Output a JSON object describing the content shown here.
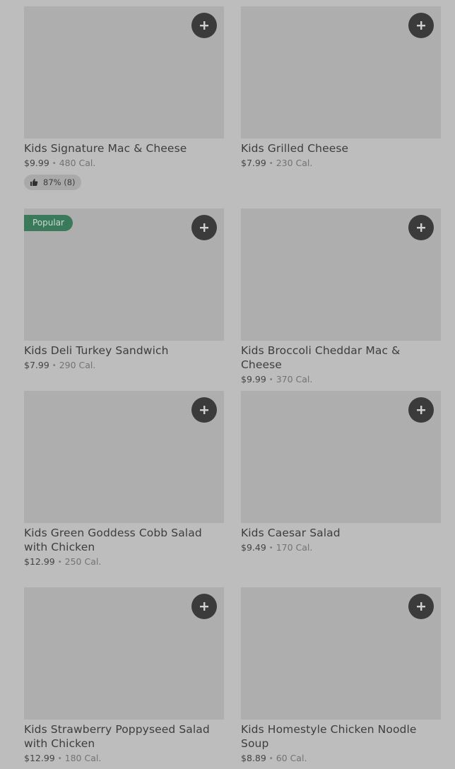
{
  "menu_items": [
    {
      "name": "Kids Signature Mac & Cheese",
      "price": "$9.99",
      "calories": "480 Cal.",
      "rating": "87% (8)"
    },
    {
      "name": "Kids Grilled Cheese",
      "price": "$7.99",
      "calories": "230 Cal."
    },
    {
      "name": "Kids Deli Turkey Sandwich",
      "price": "$7.99",
      "calories": "290 Cal.",
      "badge": "Popular"
    },
    {
      "name": "Kids Broccoli Cheddar Mac & Cheese",
      "price": "$9.99",
      "calories": "370 Cal."
    },
    {
      "name": "Kids Green Goddess Cobb Salad with Chicken",
      "price": "$12.99",
      "calories": "250 Cal."
    },
    {
      "name": "Kids Caesar Salad",
      "price": "$9.49",
      "calories": "170 Cal."
    },
    {
      "name": "Kids Strawberry Poppyseed Salad with Chicken",
      "price": "$12.99",
      "calories": "180 Cal."
    },
    {
      "name": "Kids Homestyle Chicken Noodle Soup",
      "price": "$8.89",
      "calories": "60 Cal."
    }
  ],
  "separator": "•",
  "icons": {
    "add": "plus-icon",
    "rating": "thumbs-up-icon"
  },
  "colors": {
    "badge_popular": "#3a7a5a",
    "add_button": "#3b3b3b",
    "overlay": "#bdbdbd"
  }
}
